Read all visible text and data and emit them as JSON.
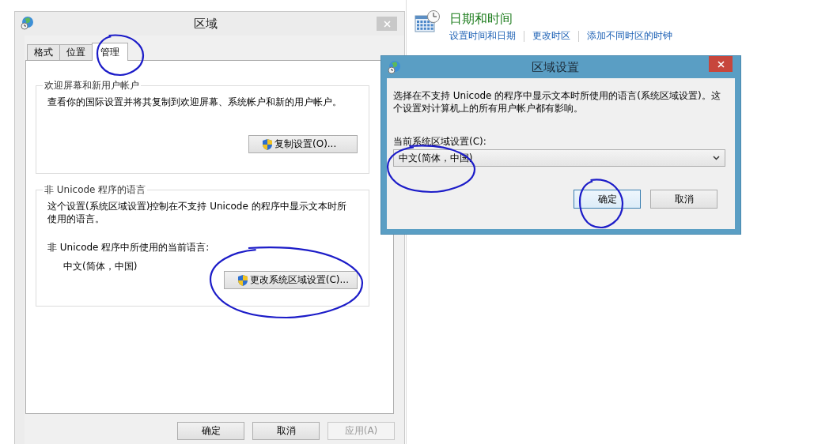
{
  "control_panel": {
    "sections": [
      {
        "title": "日期和时间",
        "links": [
          "设置时间和日期",
          "更改时区",
          "添加不同时区的时钟"
        ]
      }
    ]
  },
  "region_dialog": {
    "title": "区域",
    "active": false,
    "tabs": [
      {
        "label": "格式",
        "selected": false
      },
      {
        "label": "位置",
        "selected": false
      },
      {
        "label": "管理",
        "selected": true
      }
    ],
    "groups": [
      {
        "title": "欢迎屏幕和新用户帐户",
        "text": "查看你的国际设置并将其复制到欢迎屏幕、系统帐户和新的用户帐户。",
        "button": "复制设置(O)..."
      },
      {
        "title": "非 Unicode 程序的语言",
        "text": "这个设置(系统区域设置)控制在不支持 Unicode 的程序中显示文本时所使用的语言。",
        "current_label": "非 Unicode 程序中所使用的当前语言:",
        "current_value": "中文(简体，中国)",
        "button": "更改系统区域设置(C)..."
      }
    ],
    "buttons": [
      {
        "label": "确定",
        "disabled": false
      },
      {
        "label": "取消",
        "disabled": false
      },
      {
        "label": "应用(A)",
        "disabled": true
      }
    ]
  },
  "locale_dialog": {
    "title": "区域设置",
    "active": true,
    "text": "选择在不支持 Unicode 的程序中显示文本时所使用的语言(系统区域设置)。这个设置对计算机上的所有用户帐户都有影响。",
    "select_label": "当前系统区域设置(C):",
    "select_value": "中文(简体，中国)",
    "buttons": [
      {
        "label": "确定",
        "default": true
      },
      {
        "label": "取消",
        "default": false
      }
    ]
  }
}
